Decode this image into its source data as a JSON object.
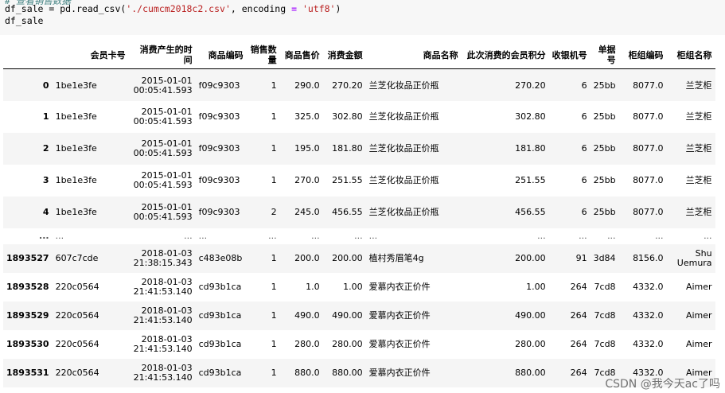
{
  "code_cell": {
    "comment": "# 查看销售数据",
    "line1_prefix": "df_sale = pd.read_csv(",
    "line1_path": "'./cumcm2018c2.csv'",
    "line1_mid": ", encoding ",
    "line1_eq": "=",
    "line1_enc": "'utf8'",
    "line1_suffix": ")",
    "line2": "df_sale"
  },
  "table": {
    "columns": [
      "会员卡号",
      "消费产生的时间",
      "商品编码",
      "销售数量",
      "商品售价",
      "消费金额",
      "商品名称",
      "此次消费的会员积分",
      "收银机号",
      "单据号",
      "柜组编码",
      "柜组名称"
    ],
    "rows": [
      {
        "index": "0",
        "cells": [
          "1be1e3fe",
          "2015-01-01 00:05:41.593",
          "f09c9303",
          "1",
          "290.0",
          "270.20",
          "兰芝化妆品正价瓶",
          "270.20",
          "6",
          "25bb",
          "8077.0",
          "兰芝柜"
        ]
      },
      {
        "index": "1",
        "cells": [
          "1be1e3fe",
          "2015-01-01 00:05:41.593",
          "f09c9303",
          "1",
          "325.0",
          "302.80",
          "兰芝化妆品正价瓶",
          "302.80",
          "6",
          "25bb",
          "8077.0",
          "兰芝柜"
        ]
      },
      {
        "index": "2",
        "cells": [
          "1be1e3fe",
          "2015-01-01 00:05:41.593",
          "f09c9303",
          "1",
          "195.0",
          "181.80",
          "兰芝化妆品正价瓶",
          "181.80",
          "6",
          "25bb",
          "8077.0",
          "兰芝柜"
        ]
      },
      {
        "index": "3",
        "cells": [
          "1be1e3fe",
          "2015-01-01 00:05:41.593",
          "f09c9303",
          "1",
          "270.0",
          "251.55",
          "兰芝化妆品正价瓶",
          "251.55",
          "6",
          "25bb",
          "8077.0",
          "兰芝柜"
        ]
      },
      {
        "index": "4",
        "cells": [
          "1be1e3fe",
          "2015-01-01 00:05:41.593",
          "f09c9303",
          "2",
          "245.0",
          "456.55",
          "兰芝化妆品正价瓶",
          "456.55",
          "6",
          "25bb",
          "8077.0",
          "兰芝柜"
        ]
      },
      {
        "index": "...",
        "cells": [
          "...",
          "...",
          "...",
          "...",
          "...",
          "...",
          "...",
          "...",
          "...",
          "...",
          "...",
          "..."
        ]
      },
      {
        "index": "1893527",
        "cells": [
          "607c7cde",
          "2018-01-03 21:38:15.343",
          "c483e08b",
          "1",
          "200.0",
          "200.00",
          "植村秀眉笔4g",
          "200.00",
          "91",
          "3d84",
          "8156.0",
          "Shu Uemura"
        ]
      },
      {
        "index": "1893528",
        "cells": [
          "220c0564",
          "2018-01-03 21:41:53.140",
          "cd93b1ca",
          "1",
          "1.0",
          "1.00",
          "爱慕内衣正价件",
          "1.00",
          "264",
          "7cd8",
          "4332.0",
          "Aimer"
        ]
      },
      {
        "index": "1893529",
        "cells": [
          "220c0564",
          "2018-01-03 21:41:53.140",
          "cd93b1ca",
          "1",
          "490.0",
          "490.00",
          "爱慕内衣正价件",
          "490.00",
          "264",
          "7cd8",
          "4332.0",
          "Aimer"
        ]
      },
      {
        "index": "1893530",
        "cells": [
          "220c0564",
          "2018-01-03 21:41:53.140",
          "cd93b1ca",
          "1",
          "280.0",
          "280.00",
          "爱慕内衣正价件",
          "280.00",
          "264",
          "7cd8",
          "4332.0",
          "Aimer"
        ]
      },
      {
        "index": "1893531",
        "cells": [
          "220c0564",
          "2018-01-03 21:41:53.140",
          "cd93b1ca",
          "1",
          "880.0",
          "880.00",
          "爱慕内衣正价件",
          "880.00",
          "264",
          "7cd8",
          "4332.0",
          "Aimer"
        ]
      }
    ]
  },
  "watermark": "CSDN @我今天ac了吗"
}
